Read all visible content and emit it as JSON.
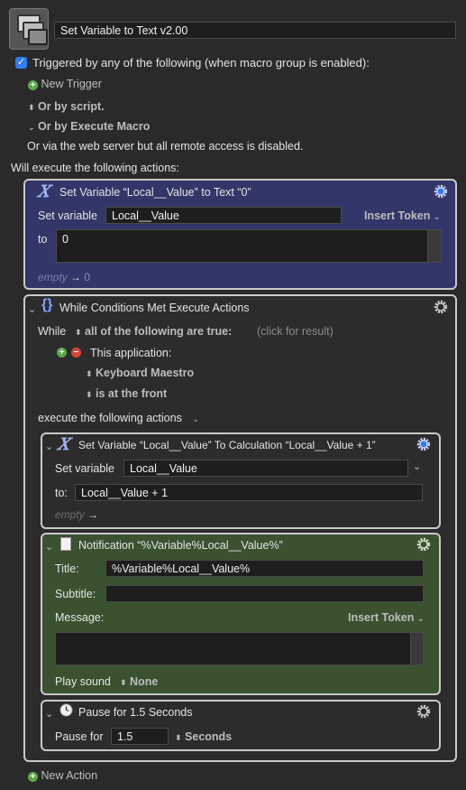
{
  "macro": {
    "name": "Set Variable to Text v2.00"
  },
  "trigger": {
    "checkbox_label": "Triggered by any of the following (when macro group is enabled):",
    "new_trigger": "New Trigger",
    "or_by_script": "Or by script.",
    "or_by_execute_macro": "Or by Execute Macro",
    "web_server_note": "Or via the web server but all remote access is disabled."
  },
  "will_execute": "Will execute the following actions:",
  "action1": {
    "title": "Set Variable “Local__Value” to Text “0”",
    "set_variable_label": "Set variable",
    "variable": "Local__Value",
    "insert_token": "Insert Token",
    "to_label": "to",
    "to_value": "0",
    "result_empty": "empty",
    "result_arrow": "→",
    "result_value": "0",
    "color": "#323668"
  },
  "while_action": {
    "title": "While Conditions Met Execute Actions",
    "while_label": "While",
    "condition_mode": "all of the following are true:",
    "click_for_result": "(click for result)",
    "condition_label": "This application:",
    "app_name": "Keyboard Maestro",
    "app_state": "is at the front",
    "execute_label": "execute the following actions"
  },
  "calc_action": {
    "title": "Set Variable “Local__Value” To Calculation “Local__Value + 1”",
    "set_variable_label": "Set variable",
    "variable": "Local__Value",
    "to_label": "to:",
    "to_value": "Local__Value + 1",
    "result_empty": "empty",
    "result_arrow": "→"
  },
  "notify_action": {
    "title": "Notification “%Variable%Local__Value%”",
    "title_label": "Title:",
    "title_value": "%Variable%Local__Value%",
    "subtitle_label": "Subtitle:",
    "subtitle_value": "",
    "message_label": "Message:",
    "insert_token": "Insert Token",
    "play_sound_label": "Play sound",
    "sound_value": "None",
    "color": "#3a5230"
  },
  "pause_action": {
    "title": "Pause for 1.5 Seconds",
    "pause_label": "Pause for",
    "pause_value": "1.5",
    "unit": "Seconds"
  },
  "new_action": "New Action"
}
